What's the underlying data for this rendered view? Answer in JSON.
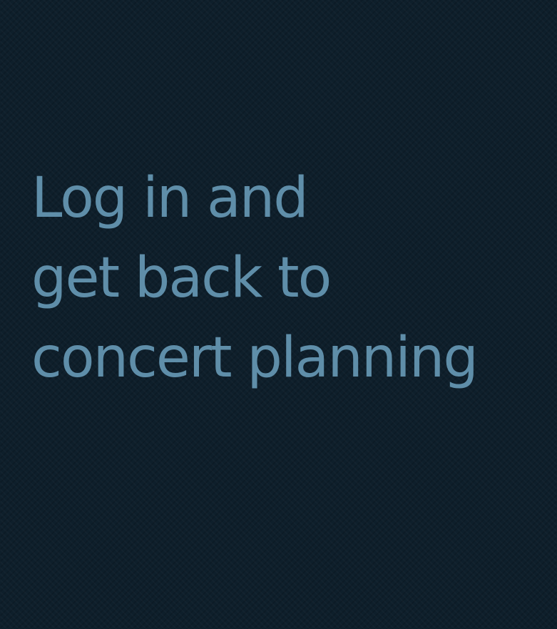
{
  "hero": {
    "lines": [
      "Log in and",
      "get back to",
      "concert planning"
    ]
  },
  "colors": {
    "background": "#0e1f2b",
    "text": "#5f8ea9"
  }
}
